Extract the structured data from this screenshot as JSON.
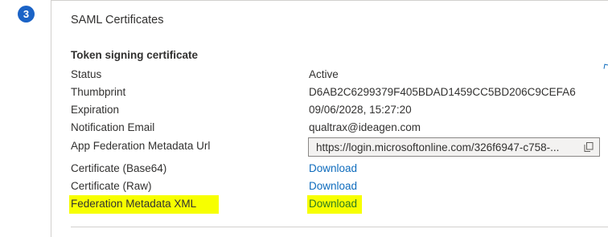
{
  "step": {
    "number": "3"
  },
  "panel": {
    "title": "SAML Certificates",
    "section_title": "Token signing certificate",
    "rows": [
      {
        "label": "Status",
        "value": "Active"
      },
      {
        "label": "Thumbprint",
        "value": "D6AB2C6299379F405BDAD1459CC5BD206C9CEFA6"
      },
      {
        "label": "Expiration",
        "value": "09/06/2028, 15:27:20"
      },
      {
        "label": "Notification Email",
        "value": "qualtrax@ideagen.com"
      },
      {
        "label": "App Federation Metadata Url",
        "value": "https://login.microsoftonline.com/326f6947-c758-..."
      },
      {
        "label": "Certificate (Base64)",
        "value": "Download"
      },
      {
        "label": "Certificate (Raw)",
        "value": "Download"
      },
      {
        "label": "Federation Metadata XML",
        "value": "Download"
      }
    ],
    "copy_icon": "copy-icon"
  },
  "colors": {
    "badge": "#1b63c6",
    "link": "#0f6cbd",
    "highlight": "#f7ff00",
    "text": "#323130",
    "border": "#d2d0ce"
  }
}
